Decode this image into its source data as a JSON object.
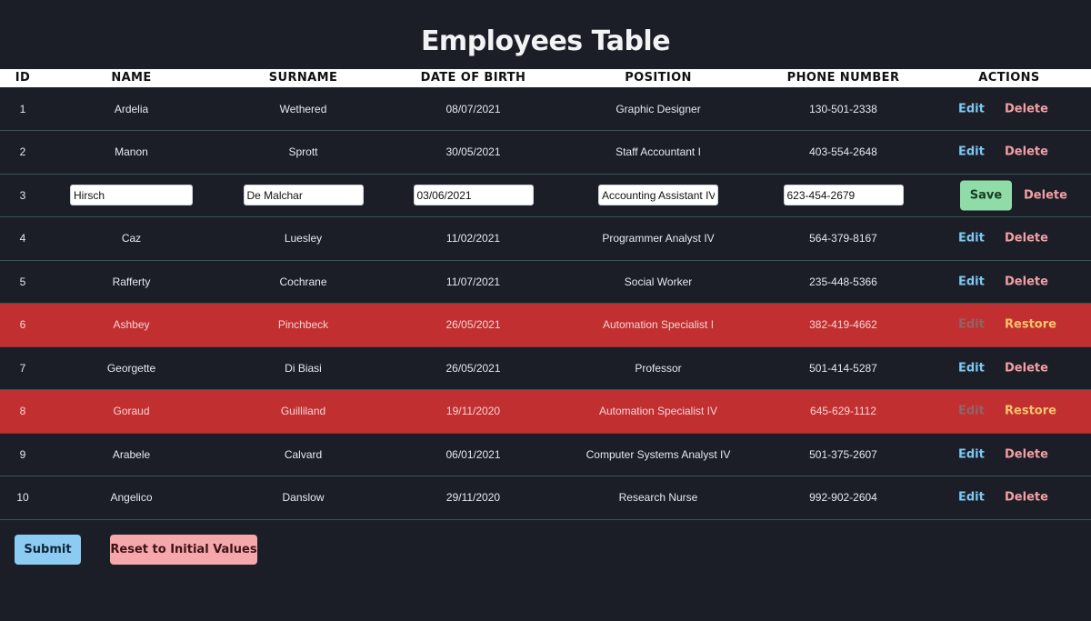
{
  "page": {
    "title": "Employees Table"
  },
  "table": {
    "columns": [
      "ID",
      "NAME",
      "SURNAME",
      "DATE OF BIRTH",
      "POSITION",
      "PHONE NUMBER",
      "ACTIONS"
    ],
    "rows": [
      {
        "id": "1",
        "name": "Ardelia",
        "surname": "Wethered",
        "dob": "08/07/2021",
        "position": "Graphic Designer",
        "phone": "130-501-2338",
        "state": "normal"
      },
      {
        "id": "2",
        "name": "Manon",
        "surname": "Sprott",
        "dob": "30/05/2021",
        "position": "Staff Accountant I",
        "phone": "403-554-2648",
        "state": "normal"
      },
      {
        "id": "3",
        "name": "Hirsch",
        "surname": "De Malchar",
        "dob": "03/06/2021",
        "position": "Accounting Assistant IV",
        "phone": "623-454-2679",
        "state": "editing"
      },
      {
        "id": "4",
        "name": "Caz",
        "surname": "Luesley",
        "dob": "11/02/2021",
        "position": "Programmer Analyst IV",
        "phone": "564-379-8167",
        "state": "normal"
      },
      {
        "id": "5",
        "name": "Rafferty",
        "surname": "Cochrane",
        "dob": "11/07/2021",
        "position": "Social Worker",
        "phone": "235-448-5366",
        "state": "normal"
      },
      {
        "id": "6",
        "name": "Ashbey",
        "surname": "Pinchbeck",
        "dob": "26/05/2021",
        "position": "Automation Specialist I",
        "phone": "382-419-4662",
        "state": "deleted"
      },
      {
        "id": "7",
        "name": "Georgette",
        "surname": "Di Biasi",
        "dob": "26/05/2021",
        "position": "Professor",
        "phone": "501-414-5287",
        "state": "normal"
      },
      {
        "id": "8",
        "name": "Goraud",
        "surname": "Guilliland",
        "dob": "19/11/2020",
        "position": "Automation Specialist IV",
        "phone": "645-629-1112",
        "state": "deleted"
      },
      {
        "id": "9",
        "name": "Arabele",
        "surname": "Calvard",
        "dob": "06/01/2021",
        "position": "Computer Systems Analyst IV",
        "phone": "501-375-2607",
        "state": "normal"
      },
      {
        "id": "10",
        "name": "Angelico",
        "surname": "Danslow",
        "dob": "29/11/2020",
        "position": "Research Nurse",
        "phone": "992-902-2604",
        "state": "normal"
      }
    ]
  },
  "actions": {
    "edit_label": "Edit",
    "delete_label": "Delete",
    "save_label": "Save",
    "restore_label": "Restore"
  },
  "footer": {
    "submit_label": "Submit",
    "reset_label": "Reset to Initial Values"
  },
  "colors": {
    "background": "#1b1e27",
    "deleted_row": "#c22f31",
    "edit_link": "#7ec8f2",
    "delete_link": "#f39fa4",
    "restore_link": "#f5c46b",
    "save_button": "#8fdca8",
    "submit_button": "#8cccf3",
    "reset_button": "#f6a7ab"
  }
}
